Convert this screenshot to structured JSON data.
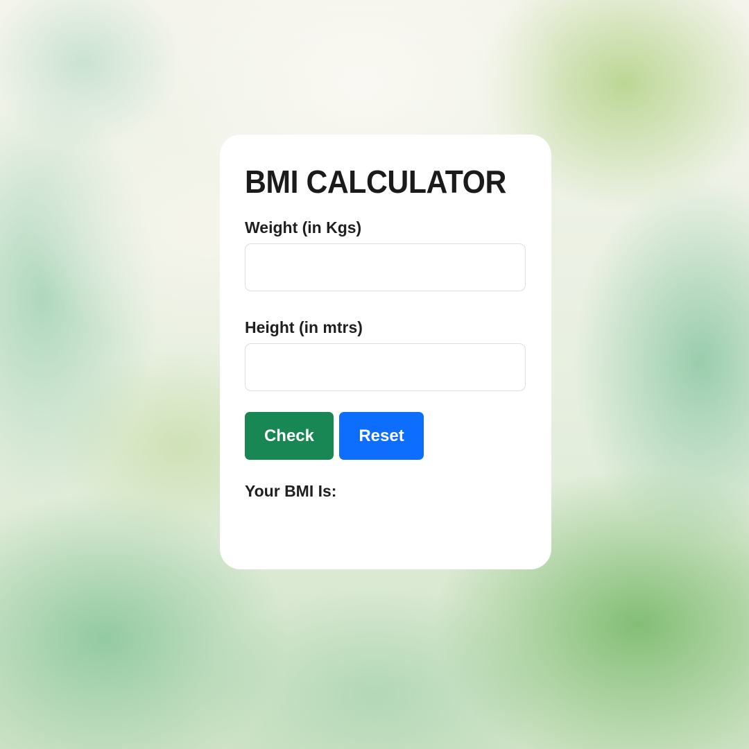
{
  "form": {
    "title": "BMI CALCULATOR",
    "weight_label": "Weight (in Kgs)",
    "weight_value": "",
    "height_label": "Height (in mtrs)",
    "height_value": "",
    "check_label": "Check",
    "reset_label": "Reset",
    "result_label": "Your BMI Is:"
  },
  "colors": {
    "check_button": "#198754",
    "reset_button": "#0d6efd",
    "card_background": "#ffffff",
    "text": "#1b1b1b"
  }
}
